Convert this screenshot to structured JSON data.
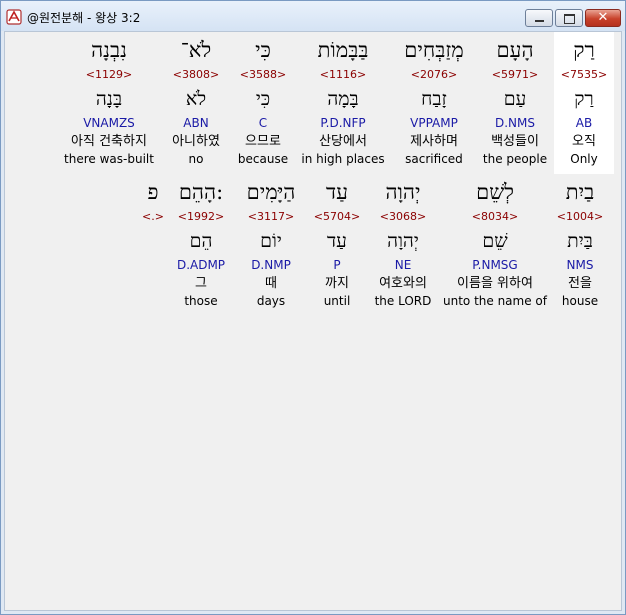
{
  "window": {
    "title": "@원전분해 - 왕상 3:2"
  },
  "rows": [
    {
      "words": [
        {
          "heb": "רַק",
          "strong": "<7535>",
          "lemma": "רַק",
          "morph": "AB",
          "kor": "오직",
          "eng": "Only"
        },
        {
          "heb": "הָעָם",
          "strong": "<5971>",
          "lemma": "עַם",
          "morph": "D.NMS",
          "kor": "백성들이",
          "eng": "the people"
        },
        {
          "heb": "מְזַבְּחִים",
          "strong": "<2076>",
          "lemma": "זָבַח",
          "morph": "VPPAMP",
          "kor": "제사하며",
          "eng": "sacrificed"
        },
        {
          "heb": "בַּבָּמוֹת",
          "strong": "<1116>",
          "lemma": "בָּמָה",
          "morph": "P.D.NFP",
          "kor": "산당에서",
          "eng": "in high places"
        },
        {
          "heb": "כִּי",
          "strong": "<3588>",
          "lemma": "כִּי",
          "morph": "C",
          "kor": "으므로",
          "eng": "because"
        },
        {
          "heb": "לֹא־",
          "strong": "<3808>",
          "lemma": "לֹא",
          "morph": "ABN",
          "kor": "아니하였",
          "eng": "no"
        },
        {
          "heb": "נִבְנָה",
          "strong": "<1129>",
          "lemma": "בָּנָה",
          "morph": "VNAMZS",
          "kor": "아직 건축하지",
          "eng": "there was-built"
        }
      ]
    },
    {
      "words": [
        {
          "heb": "בַיִת",
          "strong": "<1004>",
          "lemma": "בַּיִת",
          "morph": "NMS",
          "kor": "전을",
          "eng": "house"
        },
        {
          "heb": "לְשֵׁם",
          "strong": "<8034>",
          "lemma": "שֵׁם",
          "morph": "P.NMSG",
          "kor": "이름을 위하여",
          "eng": "unto the name of"
        },
        {
          "heb": "יְהוָה",
          "strong": "<3068>",
          "lemma": "יְהוָה",
          "morph": "NE",
          "kor": "여호와의",
          "eng": "the LORD"
        },
        {
          "heb": "עַד",
          "strong": "<5704>",
          "lemma": "עַד",
          "morph": "P",
          "kor": "까지",
          "eng": "until"
        },
        {
          "heb": "הַיָּמִים",
          "strong": "<3117>",
          "lemma": "יוֹם",
          "morph": "D.NMP",
          "kor": "때",
          "eng": "days"
        },
        {
          "heb": "הָהֵם:",
          "strong": "<1992>",
          "lemma": "הֵם",
          "morph": "D.ADMP",
          "kor": "그",
          "eng": "those"
        },
        {
          "heb": "פ",
          "strong": "<.>"
        }
      ]
    }
  ]
}
